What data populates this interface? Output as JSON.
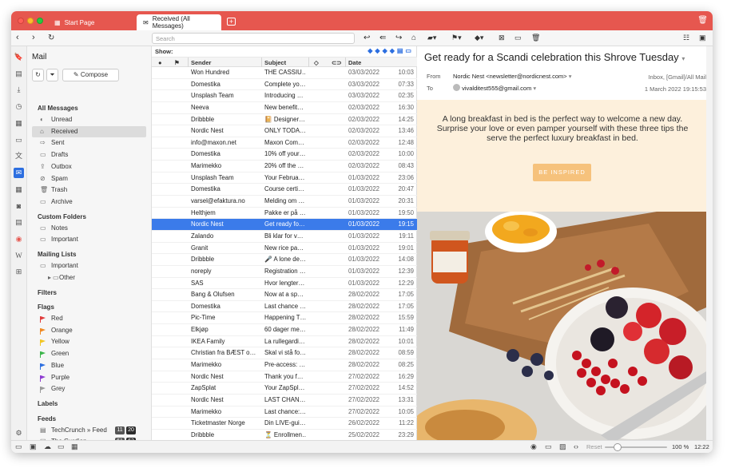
{
  "tabs": [
    {
      "label": "Start Page",
      "active": false
    },
    {
      "label": "Received (All Messages)",
      "active": true
    }
  ],
  "toolbar": {
    "search_placeholder": "Search"
  },
  "folders": {
    "title": "Mail",
    "compose_label": "Compose",
    "all_messages": "All Messages",
    "main_items": [
      "Unread",
      "Received",
      "Sent",
      "Drafts",
      "Outbox",
      "Spam",
      "Trash",
      "Archive"
    ],
    "custom_folders_head": "Custom Folders",
    "custom_items": [
      "Notes",
      "Important"
    ],
    "mailing_lists_head": "Mailing Lists",
    "mailing_items": [
      "Important",
      "Other"
    ],
    "filters_head": "Filters",
    "flags_head": "Flags",
    "flags": [
      {
        "label": "Red",
        "color": "#e03b3b"
      },
      {
        "label": "Orange",
        "color": "#f08a24"
      },
      {
        "label": "Yellow",
        "color": "#f2c623"
      },
      {
        "label": "Green",
        "color": "#3bb54a"
      },
      {
        "label": "Blue",
        "color": "#2d6fe0"
      },
      {
        "label": "Purple",
        "color": "#8e3bd1"
      },
      {
        "label": "Grey",
        "color": "#9a9a9a"
      }
    ],
    "labels_head": "Labels",
    "feeds_head": "Feeds",
    "feeds": [
      {
        "label": "TechCrunch » Feed",
        "unread": "11",
        "total": "20"
      },
      {
        "label": "The Gurdian",
        "unread": "61",
        "total": "63"
      }
    ]
  },
  "list": {
    "show_label": "Show:",
    "columns": {
      "sender": "Sender",
      "subject": "Subject",
      "date": "Date"
    },
    "rows": [
      {
        "sender": "Won Hundred",
        "subject": "THE CASSIU…",
        "date": "03/03/2022",
        "time": "10:03"
      },
      {
        "sender": "Domestika",
        "subject": "Complete yo…",
        "date": "03/03/2022",
        "time": "07:33"
      },
      {
        "sender": "Unsplash Team",
        "subject": "Introducing …",
        "date": "03/03/2022",
        "time": "02:35"
      },
      {
        "sender": "Neeva",
        "subject": "New benefit…",
        "date": "02/03/2022",
        "time": "16:30"
      },
      {
        "sender": "Dribbble",
        "subject": "📔 Designer…",
        "date": "02/03/2022",
        "time": "14:25"
      },
      {
        "sender": "Nordic Nest",
        "subject": "ONLY TODA…",
        "date": "02/03/2022",
        "time": "13:46"
      },
      {
        "sender": "info@maxon.net",
        "subject": "Maxon Com…",
        "date": "02/03/2022",
        "time": "12:48"
      },
      {
        "sender": "Domestika",
        "subject": "10% off your…",
        "date": "02/03/2022",
        "time": "10:00"
      },
      {
        "sender": "Marimekko",
        "subject": "20% off the …",
        "date": "02/03/2022",
        "time": "08:43"
      },
      {
        "sender": "Unsplash Team",
        "subject": "Your Februa…",
        "date": "01/03/2022",
        "time": "23:06"
      },
      {
        "sender": "Domestika",
        "subject": "Course certi…",
        "date": "01/03/2022",
        "time": "20:47"
      },
      {
        "sender": "varsel@efaktura.no",
        "subject": "Melding om …",
        "date": "01/03/2022",
        "time": "20:31"
      },
      {
        "sender": "Helthjem",
        "subject": "Pakke er på …",
        "date": "01/03/2022",
        "time": "19:50"
      },
      {
        "sender": "Nordic Nest",
        "subject": "Get ready fo…",
        "date": "01/03/2022",
        "time": "19:15",
        "selected": true
      },
      {
        "sender": "Zalando",
        "subject": "Bli klar for v…",
        "date": "01/03/2022",
        "time": "19:11"
      },
      {
        "sender": "Granit",
        "subject": "New rice pa…",
        "date": "01/03/2022",
        "time": "19:01"
      },
      {
        "sender": "Dribbble",
        "subject": "🎤 A lone de…",
        "date": "01/03/2022",
        "time": "14:08"
      },
      {
        "sender": "noreply",
        "subject": "Registration …",
        "date": "01/03/2022",
        "time": "12:39"
      },
      {
        "sender": "SAS",
        "subject": "Hvor lengter…",
        "date": "01/03/2022",
        "time": "12:29"
      },
      {
        "sender": "Bang & Olufsen",
        "subject": "Now at a sp…",
        "date": "28/02/2022",
        "time": "17:05"
      },
      {
        "sender": "Domestika",
        "subject": "Last chance …",
        "date": "28/02/2022",
        "time": "17:05"
      },
      {
        "sender": "Pic-Time",
        "subject": "Happening T…",
        "date": "28/02/2022",
        "time": "15:59"
      },
      {
        "sender": "Elkjøp",
        "subject": "60 dager me…",
        "date": "28/02/2022",
        "time": "11:49"
      },
      {
        "sender": "IKEA Family",
        "subject": "La rullegardi…",
        "date": "28/02/2022",
        "time": "10:01"
      },
      {
        "sender": "Christian fra BÆST o…",
        "subject": "Skal vi stå fo…",
        "date": "28/02/2022",
        "time": "08:59"
      },
      {
        "sender": "Marimekko",
        "subject": "Pre-access: …",
        "date": "28/02/2022",
        "time": "08:25"
      },
      {
        "sender": "Nordic Nest",
        "subject": "Thank you f…",
        "date": "27/02/2022",
        "time": "16:29"
      },
      {
        "sender": "ZapSplat",
        "subject": "Your ZapSpl…",
        "date": "27/02/2022",
        "time": "14:52"
      },
      {
        "sender": "Nordic Nest",
        "subject": "LAST CHAN…",
        "date": "27/02/2022",
        "time": "13:31"
      },
      {
        "sender": "Marimekko",
        "subject": "Last chance:…",
        "date": "27/02/2022",
        "time": "10:05"
      },
      {
        "sender": "Ticketmaster Norge",
        "subject": "Din LIVE-gui…",
        "date": "26/02/2022",
        "time": "11:22"
      },
      {
        "sender": "Dribbble",
        "subject": "⏳ Enrollmen…",
        "date": "25/02/2022",
        "time": "23:29"
      }
    ]
  },
  "reader": {
    "subject": "Get ready for a Scandi celebration this Shrove Tuesday",
    "from_label": "From",
    "from_value": "Nordic Nest <newsletter@nordicnest.com>",
    "to_label": "To",
    "to_value": "vivalditest555@gmail.com",
    "folder_path": "Inbox, [Gmail]/All Mail",
    "received": "1 March 2022 19:15:53",
    "promo_text": "A long breakfast in bed is the perfect way to welcome a new day. Surprise your love or even pamper yourself with these three tips the serve the perfect luxury breakfast in bed.",
    "promo_button": "BE INSPIRED"
  },
  "statusbar": {
    "reset": "Reset",
    "zoom": "100 %",
    "clock": "12:22",
    "zoom_level_percent": 100
  }
}
